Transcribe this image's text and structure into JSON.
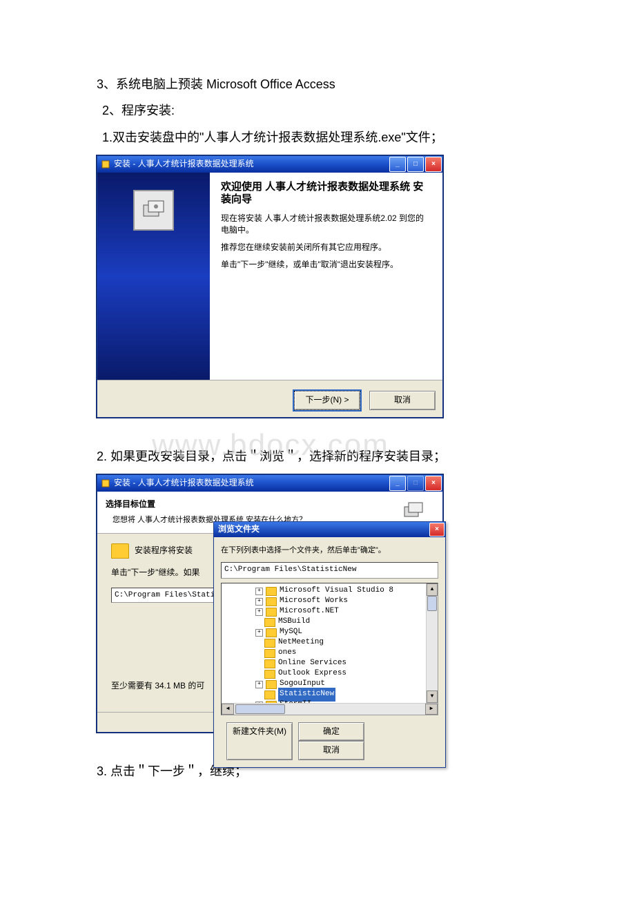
{
  "watermark": "www.bdocx.com",
  "doc": {
    "line1": "3、系统电脑上预装 Microsoft Office Access",
    "line2": "2、程序安装:",
    "line3": "1.双击安装盘中的\"人事人才统计报表数据处理系统.exe\"文件；",
    "line4": "2. 如果更改安装目录，点击＂浏览＂，选择新的程序安装目录；",
    "line5": "3. 点击＂下一步＂，继续；"
  },
  "wiz1": {
    "title": "安装 - 人事人才统计报表数据处理系统",
    "heading": "欢迎使用 人事人才统计报表数据处理系统 安装向导",
    "p1": "现在将安装 人事人才统计报表数据处理系统2.02 到您的电脑中。",
    "p2": "推荐您在继续安装前关闭所有其它应用程序。",
    "p3": "单击\"下一步\"继续，或单击\"取消\"退出安装程序。",
    "next": "下一步(N) >",
    "cancel": "取消"
  },
  "wiz2": {
    "title": "安装 - 人事人才统计报表数据处理系统",
    "heading": "选择目标位置",
    "sub": "您想将 人事人才统计报表数据处理系统 安装在什么地方？",
    "folderLine": "安装程序将安装",
    "instr": "单击\"下一步\"继续。如果",
    "path": "C:\\Program Files\\Statis",
    "space": "至少需要有 34.1 MB 的可"
  },
  "browse": {
    "title": "浏览文件夹",
    "instr": "在下列列表中选择一个文件夹，然后单击\"确定\"。",
    "path": "C:\\Program Files\\StatisticNew",
    "tree": [
      {
        "pm": "+",
        "label": "Microsoft Visual Studio 8",
        "indent": 3
      },
      {
        "pm": "+",
        "label": "Microsoft Works",
        "indent": 3
      },
      {
        "pm": "+",
        "label": "Microsoft.NET",
        "indent": 3
      },
      {
        "pm": "",
        "label": "MSBuild",
        "indent": 3
      },
      {
        "pm": "+",
        "label": "MySQL",
        "indent": 3
      },
      {
        "pm": "",
        "label": "NetMeeting",
        "indent": 3
      },
      {
        "pm": "",
        "label": "ones",
        "indent": 3
      },
      {
        "pm": "",
        "label": "Online Services",
        "indent": 3
      },
      {
        "pm": "",
        "label": "Outlook Express",
        "indent": 3
      },
      {
        "pm": "+",
        "label": "SogouInput",
        "indent": 3
      },
      {
        "pm": "",
        "label": "StatisticNew",
        "indent": 3,
        "selected": true
      },
      {
        "pm": "+",
        "label": "StormII",
        "indent": 3
      }
    ],
    "newFolder": "新建文件夹(M)",
    "ok": "确定",
    "cancel": "取消"
  }
}
